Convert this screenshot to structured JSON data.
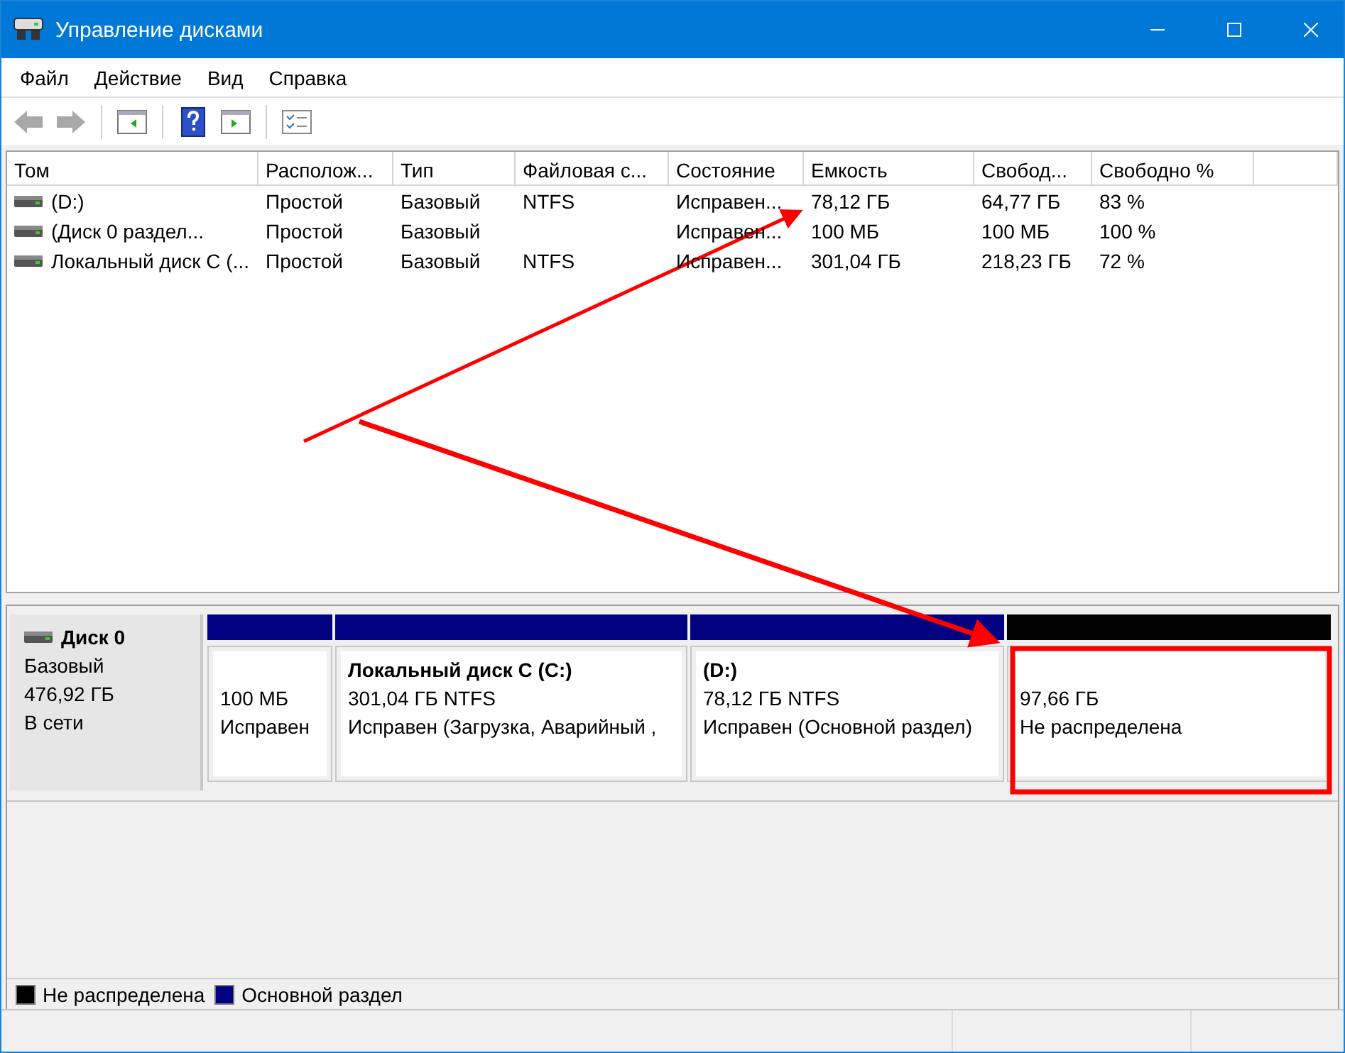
{
  "window": {
    "title": "Управление дисками"
  },
  "menu": [
    "Файл",
    "Действие",
    "Вид",
    "Справка"
  ],
  "toolbar": [
    {
      "kind": "back",
      "disabled": true
    },
    {
      "kind": "forward",
      "disabled": true
    },
    {
      "kind": "sep"
    },
    {
      "kind": "panel-left"
    },
    {
      "kind": "sep"
    },
    {
      "kind": "help"
    },
    {
      "kind": "panel-right"
    },
    {
      "kind": "sep"
    },
    {
      "kind": "list"
    }
  ],
  "table": {
    "columns": [
      "Том",
      "Располож...",
      "Тип",
      "Файловая с...",
      "Состояние",
      "Емкость",
      "Свобод...",
      "Свободно %"
    ],
    "rows": [
      [
        "(D:)",
        "Простой",
        "Базовый",
        "NTFS",
        "Исправен...",
        "78,12 ГБ",
        "64,77 ГБ",
        "83 %"
      ],
      [
        "(Диск 0 раздел...",
        "Простой",
        "Базовый",
        "",
        "Исправен...",
        "100 МБ",
        "100 МБ",
        "100 %"
      ],
      [
        "Локальный диск C (...",
        "Простой",
        "Базовый",
        "NTFS",
        "Исправен...",
        "301,04 ГБ",
        "218,23 ГБ",
        "72 %"
      ]
    ]
  },
  "disk": {
    "name": "Диск 0",
    "type": "Базовый",
    "size": "476,92 ГБ",
    "status": "В сети",
    "partitions": [
      {
        "color": "#000080",
        "lines": [
          "100 МБ",
          "Исправен"
        ]
      },
      {
        "color": "#000080",
        "title": "Локальный диск C  (C:)",
        "lines": [
          "301,04 ГБ NTFS",
          "Исправен (Загрузка, Аварийный ,"
        ]
      },
      {
        "color": "#000080",
        "title": "(D:)",
        "lines": [
          "78,12 ГБ NTFS",
          "Исправен (Основной раздел)"
        ]
      },
      {
        "color": "#000000",
        "lines": [
          "97,66 ГБ",
          "Не распределена"
        ]
      }
    ]
  },
  "legend": [
    {
      "label": "Не распределена",
      "color": "#000000"
    },
    {
      "label": "Основной раздел",
      "color": "#000080"
    }
  ]
}
